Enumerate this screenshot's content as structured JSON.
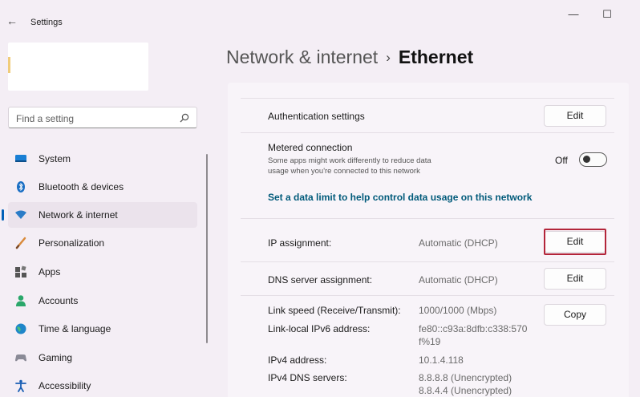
{
  "window": {
    "title": "Settings",
    "back_glyph": "←",
    "minimize_glyph": "—",
    "maximize_glyph": "☐"
  },
  "search": {
    "placeholder": "Find a setting"
  },
  "sidebar": {
    "selected": "Network & internet",
    "items": [
      {
        "label": "System",
        "icon": "system-icon"
      },
      {
        "label": "Bluetooth & devices",
        "icon": "bluetooth-icon"
      },
      {
        "label": "Network & internet",
        "icon": "wifi-icon"
      },
      {
        "label": "Personalization",
        "icon": "brush-icon"
      },
      {
        "label": "Apps",
        "icon": "apps-icon"
      },
      {
        "label": "Accounts",
        "icon": "person-icon"
      },
      {
        "label": "Time & language",
        "icon": "globe-clock-icon"
      },
      {
        "label": "Gaming",
        "icon": "gamepad-icon"
      },
      {
        "label": "Accessibility",
        "icon": "accessibility-icon"
      }
    ]
  },
  "breadcrumb": {
    "parent": "Network & internet",
    "separator": "›",
    "current": "Ethernet"
  },
  "settings": {
    "authentication": {
      "label": "Authentication settings",
      "button": "Edit"
    },
    "metered": {
      "label": "Metered connection",
      "description_line1": "Some apps might work differently to reduce data",
      "description_line2": "usage when you're connected to this network",
      "state_label": "Off",
      "enabled": false
    },
    "data_limit_link": "Set a data limit to help control data usage on this network",
    "ip_assignment": {
      "label": "IP assignment:",
      "value": "Automatic (DHCP)",
      "button": "Edit"
    },
    "dns_assignment": {
      "label": "DNS server assignment:",
      "value": "Automatic (DHCP)",
      "button": "Edit"
    },
    "properties": {
      "copy_button": "Copy",
      "link_speed": {
        "label": "Link speed (Receive/Transmit):",
        "value": "1000/1000 (Mbps)"
      },
      "ipv6": {
        "label": "Link-local IPv6 address:",
        "value_line1": "fe80::c93a:8dfb:c338:570",
        "value_line2": "f%19"
      },
      "ipv4": {
        "label": "IPv4 address:",
        "value": "10.1.4.118"
      },
      "ipv4_dns": {
        "label": "IPv4 DNS servers:",
        "value_line1": "8.8.8.8 (Unencrypted)",
        "value_line2": "8.8.4.4 (Unencrypted)"
      }
    }
  },
  "colors": {
    "accent": "#0060b8",
    "link": "#005a7a",
    "highlight_box": "#b3253a",
    "window_bg": "#f4eef5"
  }
}
